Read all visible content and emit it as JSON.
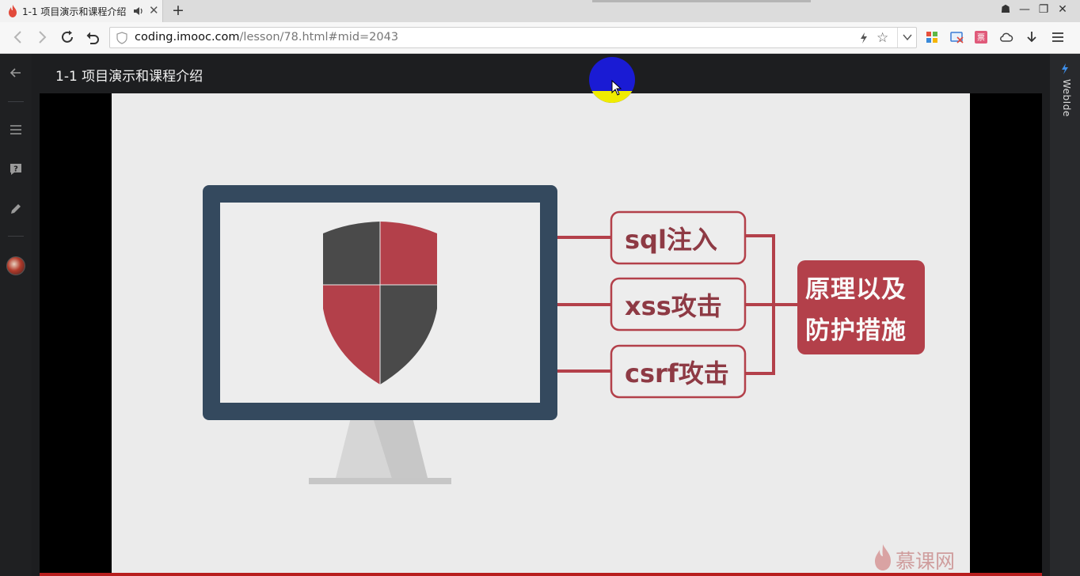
{
  "browser": {
    "tab_title": "1-1 项目演示和课程介绍",
    "tab_close_glyph": "✕",
    "new_tab_glyph": "+",
    "url_host": "coding.imooc.com",
    "url_path": "/lesson/78.html#mid=2043",
    "window_controls": [
      "☗",
      "—",
      "❐",
      "✕"
    ]
  },
  "page": {
    "lesson_title": "1-1 项目演示和课程介绍",
    "side_panel_label": "WebIde"
  },
  "slide": {
    "topics": [
      "sql注入",
      "xss攻击",
      "csrf攻击"
    ],
    "summary_line1": "原理以及",
    "summary_line2": "防护措施",
    "watermark": "慕课网"
  },
  "colors": {
    "accent_red": "#b3404a",
    "monitor_frame": "#34495e",
    "shield_dark": "#4a4a4a",
    "progress_red": "#b81e1e"
  }
}
